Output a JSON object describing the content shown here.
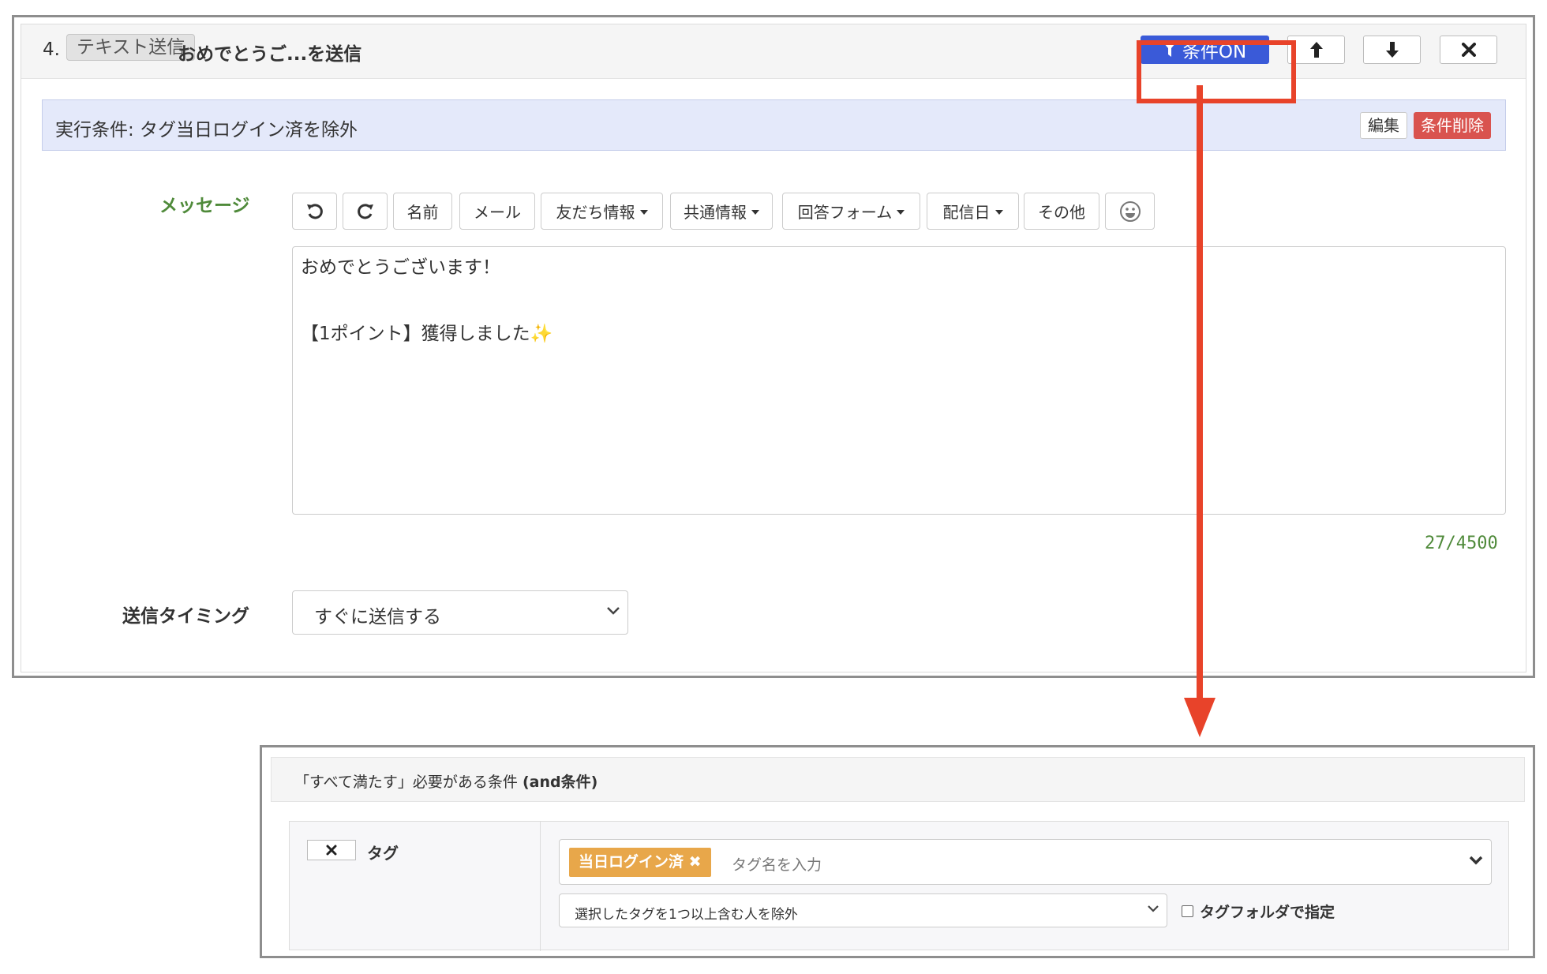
{
  "step": {
    "number": "4.",
    "type_badge": "テキスト送信",
    "title": "おめでとうご...を送信",
    "condition_button": "条件ON"
  },
  "condition_bar": {
    "text": "実行条件: タグ当日ログイン済を除外",
    "edit_label": "編集",
    "delete_label": "条件削除"
  },
  "message": {
    "label": "メッセージ",
    "toolbar": {
      "name": "名前",
      "mail": "メール",
      "friend_info": "友だち情報",
      "common_info": "共通情報",
      "answer_form": "回答フォーム",
      "delivery_date": "配信日",
      "other": "その他"
    },
    "line1": "おめでとうございます！",
    "line2": "【1ポイント】獲得しました✨",
    "counter": "27/4500"
  },
  "timing": {
    "label": "送信タイミング",
    "value": "すぐに送信する"
  },
  "conditions_panel": {
    "header_prefix": "「すべて満たす」必要がある条件 ",
    "header_bold": "(and条件)",
    "row_label": "タグ",
    "tag_chip": "当日ログイン済 ✖",
    "tag_placeholder": "タグ名を入力",
    "mode_value": "選択したタグを1つ以上含む人を除外",
    "folder_label": "タグフォルダで指定"
  },
  "colors": {
    "primary": "#3a5ad8",
    "danger": "#d9534f",
    "highlight": "#e8432a",
    "tag": "#e8a74a",
    "label_green": "#4f8a3a"
  }
}
